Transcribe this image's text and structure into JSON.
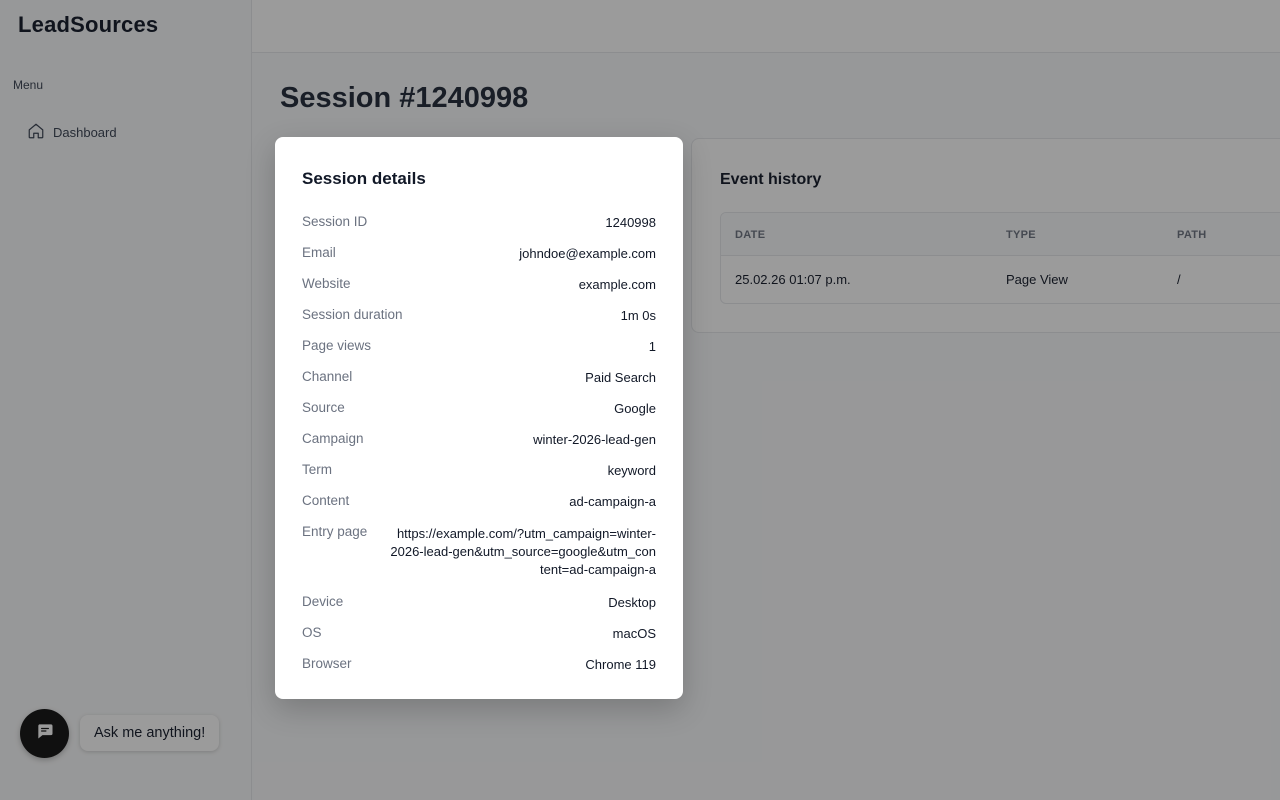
{
  "sidebar": {
    "logo": "LeadSources",
    "menu_label": "Menu",
    "items": [
      {
        "label": "Dashboard",
        "icon": "home-icon"
      }
    ]
  },
  "page": {
    "title": "Session #1240998"
  },
  "events": {
    "title": "Event history",
    "columns": [
      "DATE",
      "TYPE",
      "PATH"
    ],
    "rows": [
      {
        "date": "25.02.26 01:07 p.m.",
        "type": "Page View",
        "path": "/"
      }
    ]
  },
  "chat": {
    "bubble": "Ask me anything!",
    "icon": "chat-icon"
  },
  "modal": {
    "title": "Session details",
    "rows": [
      {
        "label": "Session ID",
        "value": "1240998"
      },
      {
        "label": "Email",
        "value": "johndoe@example.com"
      },
      {
        "label": "Website",
        "value": "example.com"
      },
      {
        "label": "Session duration",
        "value": "1m 0s"
      },
      {
        "label": "Page views",
        "value": "1"
      },
      {
        "label": "Channel",
        "value": "Paid Search"
      },
      {
        "label": "Source",
        "value": "Google"
      },
      {
        "label": "Campaign",
        "value": "winter-2026-lead-gen"
      },
      {
        "label": "Term",
        "value": "keyword"
      },
      {
        "label": "Content",
        "value": "ad-campaign-a"
      },
      {
        "label": "Entry page",
        "value": "https://example.com/?utm_campaign=winter-2026-lead-gen&utm_source=google&utm_content=ad-campaign-a"
      },
      {
        "label": "Device",
        "value": "Desktop"
      },
      {
        "label": "OS",
        "value": "macOS"
      },
      {
        "label": "Browser",
        "value": "Chrome 119"
      }
    ]
  },
  "colors": {
    "overlay": "#111111",
    "accent": "#111827"
  }
}
